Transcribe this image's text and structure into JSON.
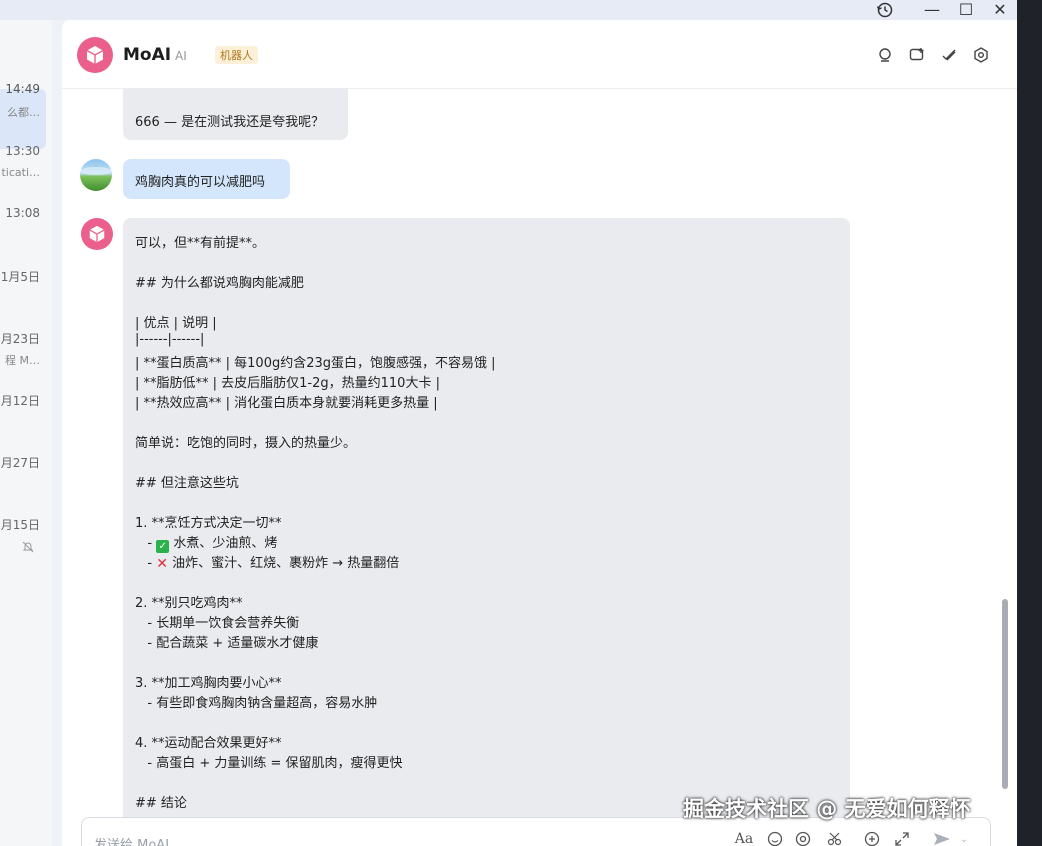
{
  "window": {
    "history_icon": "history-icon",
    "minimize_glyph": "—",
    "maximize_glyph": "☐",
    "close_glyph": "✕"
  },
  "sidebar": {
    "items": [
      {
        "time": "14:49",
        "preview": "么都…"
      },
      {
        "time": "13:30",
        "preview": "ticati…"
      },
      {
        "time": "13:08",
        "preview": ""
      },
      {
        "time": "1月5日",
        "preview": ""
      },
      {
        "time": "月23日",
        "preview": "程 M…"
      },
      {
        "time": "月12日",
        "preview": ""
      },
      {
        "time": "2月27日",
        "preview": ""
      },
      {
        "time": "月15日",
        "preview": ""
      }
    ]
  },
  "header": {
    "title": "MoAI",
    "ai_tag": "AI",
    "badge": "机器人"
  },
  "messages": {
    "prev_bot_text": "666 — 是在测试我还是夸我呢？",
    "user_text": "鸡胸肉真的可以减肥吗",
    "reply_lines": [
      "可以，但**有前提**。",
      "",
      "## 为什么都说鸡胸肉能减肥",
      "",
      "| 优点 | 说明 |",
      "|------|------|",
      "| **蛋白质高** | 每100g约含23g蛋白，饱腹感强，不容易饿 |",
      "| **脂肪低** | 去皮后脂肪仅1-2g，热量约110大卡 |",
      "| **热效应高** | 消化蛋白质本身就要消耗更多热量 |",
      "",
      "简单说：吃饱的同时，摄入的热量少。",
      "",
      "## 但注意这些坑",
      "",
      "1. **烹饪方式决定一切**",
      "   - ✅ 水煮、少油煎、烤",
      "   - ❌ 油炸、蜜汁、红烧、裹粉炸 → 热量翻倍",
      "",
      "2. **别只吃鸡肉**",
      "   - 长期单一饮食会营养失衡",
      "   - 配合蔬菜 + 适量碳水才健康",
      "",
      "3. **加工鸡胸肉要小心**",
      "   - 有些即食鸡胸肉钠含量超高，容易水肿",
      "",
      "4. **运动配合效果更好**",
      "   - 高蛋白 + 力量训练 = 保留肌肉，瘦得更快",
      "",
      "## 结论"
    ]
  },
  "input": {
    "placeholder": "发送给 MoAI"
  },
  "watermark": "掘金技术社区 @ 无爱如何释怀"
}
